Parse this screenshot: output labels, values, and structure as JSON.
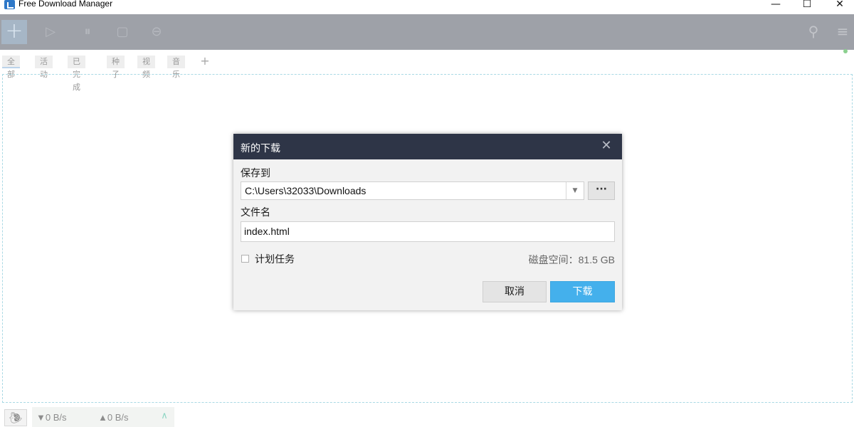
{
  "window": {
    "title": "Free Download Manager",
    "logo_icon": "fdm-logo-icon",
    "controls": {
      "minimize": "—",
      "maximize": "☐",
      "close": "✕"
    }
  },
  "toolbar": {
    "add_symbol": "+",
    "icons": [
      "add-icon",
      "play-icon",
      "pause-icon",
      "stop-icon",
      "delete-icon",
      "search-icon",
      "menu-icon"
    ],
    "play_glyph": "▷",
    "pause_glyph": "⏸",
    "stop_glyph": "▢",
    "delete_glyph": "⊖",
    "search_glyph": "⚲",
    "menu_glyph": "≡"
  },
  "tabs": [
    {
      "label": "全部",
      "active": true
    },
    {
      "label": "活动",
      "active": false
    },
    {
      "label": "已完成",
      "active": false
    },
    {
      "label": "种子",
      "active": false
    },
    {
      "label": "视频",
      "active": false
    },
    {
      "label": "音乐",
      "active": false
    }
  ],
  "tab_add": "+",
  "dialog": {
    "title": "新的下载",
    "close": "✕",
    "save_to_label": "保存到",
    "save_path": "C:\\Users\\32033\\Downloads",
    "browse_label": "···",
    "filename_label": "文件名",
    "filename_value": "index.html",
    "schedule_label": "计划任务",
    "schedule_checked": false,
    "disk_space": "磁盘空间：81.5 GB",
    "cancel_label": "取消",
    "download_label": "下载"
  },
  "statusbar": {
    "snail_icon": "snail-icon",
    "download_speed": "▼0 B/s",
    "upload_speed": "▲0 B/s",
    "expand_glyph": "∧"
  },
  "colors": {
    "accent": "#44b0ec",
    "dialog_header": "#2e3547",
    "toolbar_dimmed": "#9ea1a8",
    "drop_border": "#a9d9e4"
  }
}
